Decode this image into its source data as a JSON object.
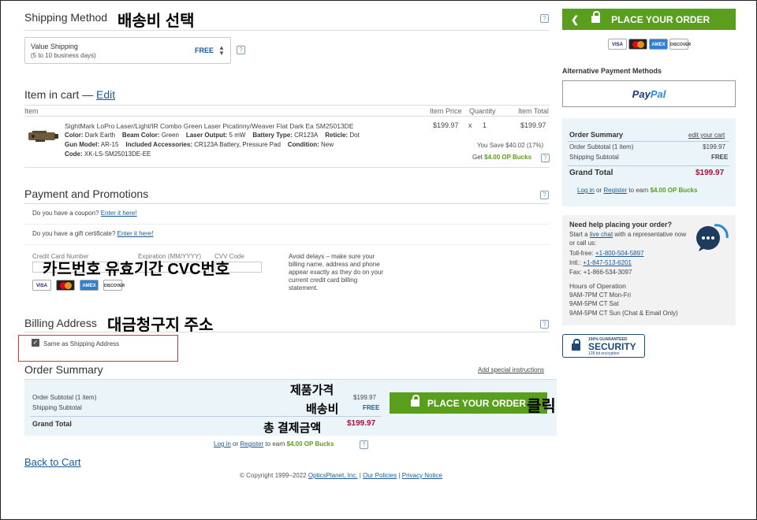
{
  "shipping": {
    "title": "Shipping Method",
    "title_ko": "배송비 선택",
    "option_name": "Value Shipping",
    "option_days": "(5 to 10 business days)",
    "option_price": "FREE"
  },
  "cart": {
    "title": "Item in cart —",
    "edit_link": "Edit",
    "col_item": "Item",
    "col_price": "Item Price",
    "col_qty": "Quantity",
    "col_total": "Item Total",
    "product_name": "SightMark LoPro Laser/Light/IR Combo Green Laser Picatinny/Weaver Flat Dark Ea SM25013DE",
    "color_label": "Color:",
    "color_value": "Dark Earth",
    "beam_label": "Beam Color:",
    "beam_value": "Green",
    "output_label": "Laser Output:",
    "output_value": "5 mW",
    "battery_label": "Battery Type:",
    "battery_value": "CR123A",
    "reticle_label": "Reticle:",
    "reticle_value": "Dot",
    "mount_label": "Gun Model:",
    "mount_value": "AR-15",
    "acc_label": "Included Accessories:",
    "acc_value": "CR123A Battery, Pressure Pad",
    "cond_label": "Condition:",
    "cond_value": "New",
    "code_label": "Code:",
    "code_value": "XK-LS-SM25013DE-EE",
    "price": "$199.97",
    "times": "x",
    "qty": "1",
    "total": "$199.97",
    "you_save": "You Save $40.02 (17%)",
    "get_text": "Get",
    "bucks": "$4.00 OP Bucks"
  },
  "payment": {
    "title": "Payment and Promotions",
    "coupon_q": "Do you have a coupon?",
    "coupon_link": "Enter it here!",
    "gift_q": "Do you have a gift certificate?",
    "gift_link": "Enter it here!",
    "cc_label": "Credit Card Number",
    "exp_label": "Expiration (MM/YYYY)",
    "cvv_label": "CVV Code",
    "ko_label": "카드번호 유효기간 CVC번호",
    "note": "Avoid delays – make sure your billing name, address and phone appear exactly as they do on your current credit card billing statement."
  },
  "billing": {
    "title": "Billing Address",
    "title_ko": "대금청구지 주소",
    "same_label": "Same as Shipping Address"
  },
  "order_summary": {
    "title": "Order Summary",
    "special_link": "Add special instructions",
    "subtotal_label": "Order Subtotal (1 item)",
    "subtotal_value": "$199.97",
    "shipping_label": "Shipping Subtotal",
    "shipping_value": "FREE",
    "grand_label": "Grand Total",
    "grand_value": "$199.97",
    "ko_price": "제품가격",
    "ko_shipping": "배송비",
    "ko_total": "총 결제금액",
    "ko_click": "클릭",
    "place_order": "PLACE YOUR ORDER",
    "login": "Log in",
    "or": "or",
    "register": "Register",
    "to_earn": "to earn",
    "bucks": "$4.00 OP Bucks"
  },
  "back_to_cart": "Back to Cart",
  "footer": {
    "copyright": "© Copyright 1999–2022",
    "company": "OpticsPlanet, Inc.",
    "policies": "Our Policies",
    "privacy": "Privacy Notice",
    "sep": "|"
  },
  "sidebar": {
    "place_order": "PLACE YOUR ORDER",
    "alt_title": "Alternative Payment Methods",
    "paypal_pay": "Pay",
    "paypal_pal": "Pal",
    "summary_title": "Order Summary",
    "edit_cart": "edit your cart",
    "subtotal_label": "Order Subtotal (1 item)",
    "subtotal_value": "$199.97",
    "shipping_label": "Shipping Subtotal",
    "shipping_value": "FREE",
    "grand_label": "Grand Total",
    "grand_value": "$199.97",
    "login": "Log in",
    "or": "or",
    "register": "Register",
    "to_earn": "to earn",
    "bucks": "$4.00 OP Bucks",
    "help_title": "Need help placing your order?",
    "help_start": "Start a",
    "help_chat": "live chat",
    "help_rest": "with a representative now or call us:",
    "tollfree_label": "Toll-free:",
    "tollfree": "+1-800-504-5897",
    "intl_label": "Intl.:",
    "intl": "+1-847-513-6201",
    "fax": "Fax: +1-866-534-3097",
    "hours_title": "Hours of Operation",
    "hours1": "9AM-7PM CT Mon-Fri",
    "hours2": "9AM-5PM CT Sat",
    "hours3": "9AM-5PM CT Sun (Chat & Email Only)",
    "seal_top": "100% GUARANTEED",
    "seal_main": "SECURITY",
    "seal_bottom": "128 bit encryption"
  },
  "cards": {
    "visa": "VISA",
    "amex": "AMEX",
    "discover": "DISCOVER"
  },
  "colors": {
    "accent_green": "#5a9e1e",
    "link_blue": "#1a5a96",
    "price_red": "#a3123a",
    "summary_bg": "#eaf4f9"
  }
}
